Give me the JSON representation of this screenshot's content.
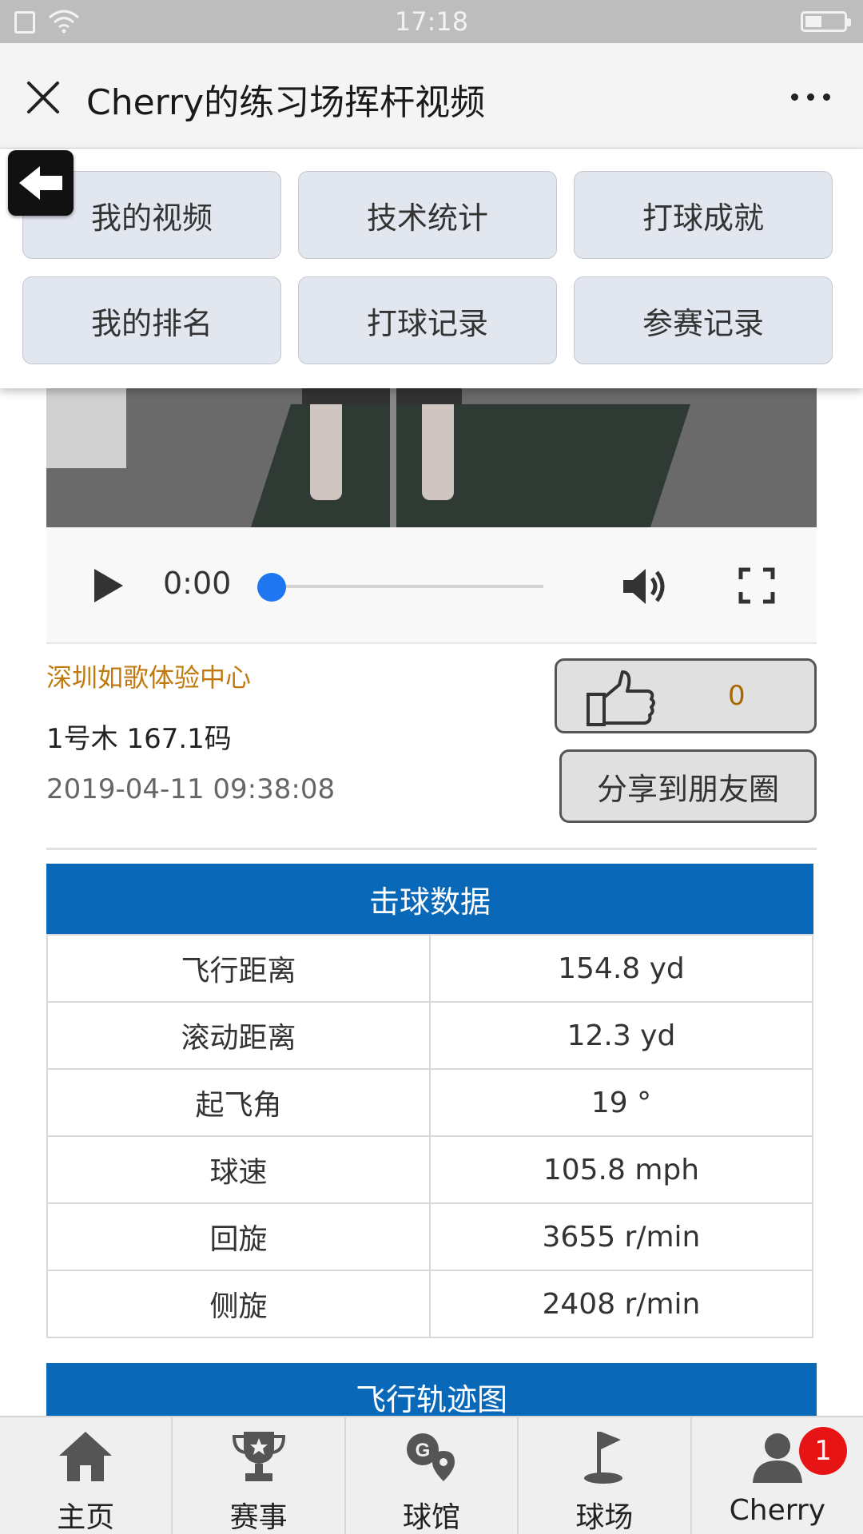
{
  "status_bar": {
    "time": "17:18"
  },
  "title_bar": {
    "title": "Cherry的练习场挥杆视频"
  },
  "menu": {
    "items": [
      "我的视频",
      "技术统计",
      "打球成就",
      "我的排名",
      "打球记录",
      "参赛记录"
    ]
  },
  "video": {
    "current_time": "0:00",
    "progress": 0
  },
  "info": {
    "venue": "深圳如歌体验中心",
    "club_distance": "1号木 167.1码",
    "datetime": "2019-04-11 09:38:08",
    "likes": "0",
    "share_label": "分享到朋友圈"
  },
  "shot_data": {
    "title": "击球数据",
    "rows": [
      {
        "label": "飞行距离",
        "value": "154.8 yd"
      },
      {
        "label": "滚动距离",
        "value": "12.3 yd"
      },
      {
        "label": "起飞角",
        "value": "19 °"
      },
      {
        "label": "球速",
        "value": "105.8 mph"
      },
      {
        "label": "回旋",
        "value": "3655 r/min"
      },
      {
        "label": "侧旋",
        "value": "2408 r/min"
      }
    ]
  },
  "trajectory": {
    "title": "飞行轨迹图"
  },
  "bottom_nav": {
    "items": [
      {
        "label": "主页",
        "icon": "home-icon"
      },
      {
        "label": "赛事",
        "icon": "trophy-icon"
      },
      {
        "label": "球馆",
        "icon": "location-pin-icon"
      },
      {
        "label": "球场",
        "icon": "golf-flag-icon"
      },
      {
        "label": "Cherry",
        "icon": "user-icon"
      }
    ],
    "badge_count": "1"
  },
  "colors": {
    "accent_blue": "#0a68b8",
    "venue_orange": "#c07a10",
    "badge_red": "#e61414",
    "progress_blue": "#1e77f0"
  }
}
